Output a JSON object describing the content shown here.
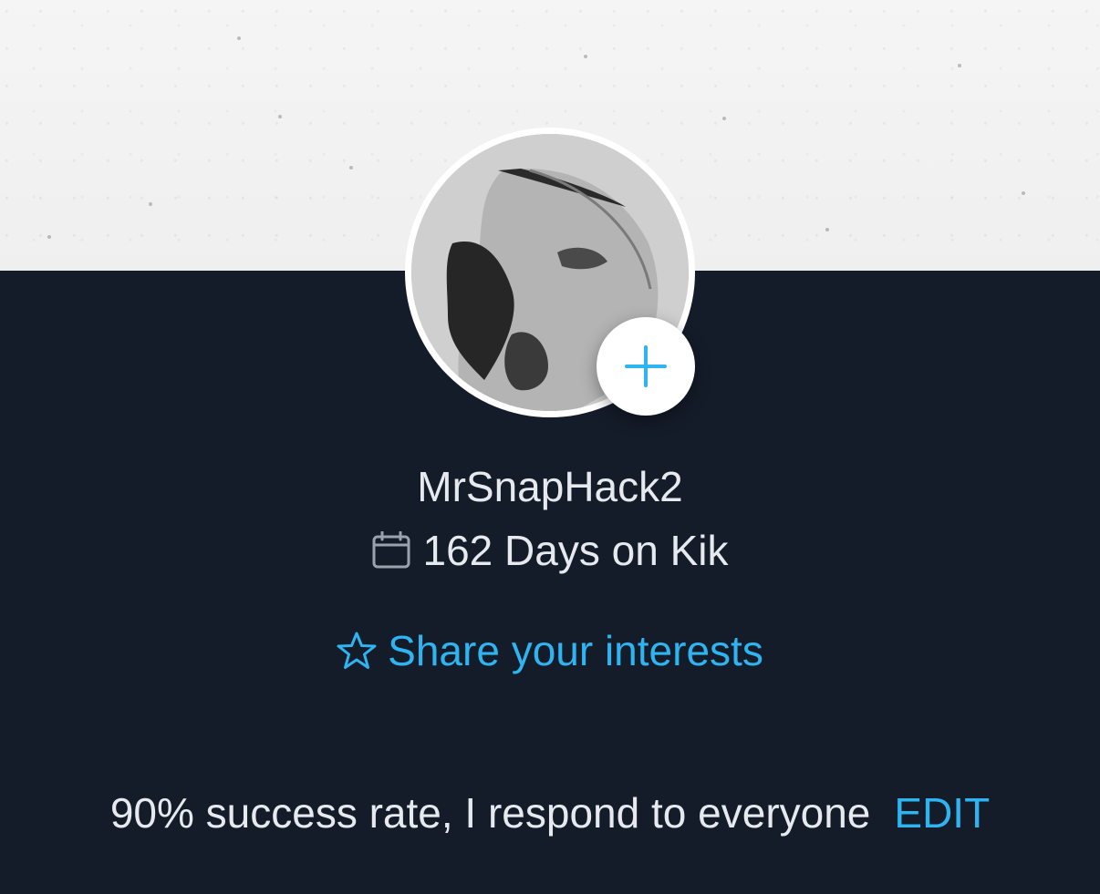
{
  "profile": {
    "username": "MrSnapHack2",
    "days_on_kik": "162 Days on Kik",
    "share_interests": "Share your interests",
    "bio": "90% success rate, I respond to everyone",
    "edit_label": "EDIT"
  },
  "icons": {
    "calendar": "calendar-icon",
    "star": "star-outline-icon",
    "plus": "plus-icon"
  },
  "colors": {
    "background": "#141c29",
    "accent": "#2fb4f2",
    "text": "#e6e9ee",
    "cover": "#f2f2f2"
  }
}
